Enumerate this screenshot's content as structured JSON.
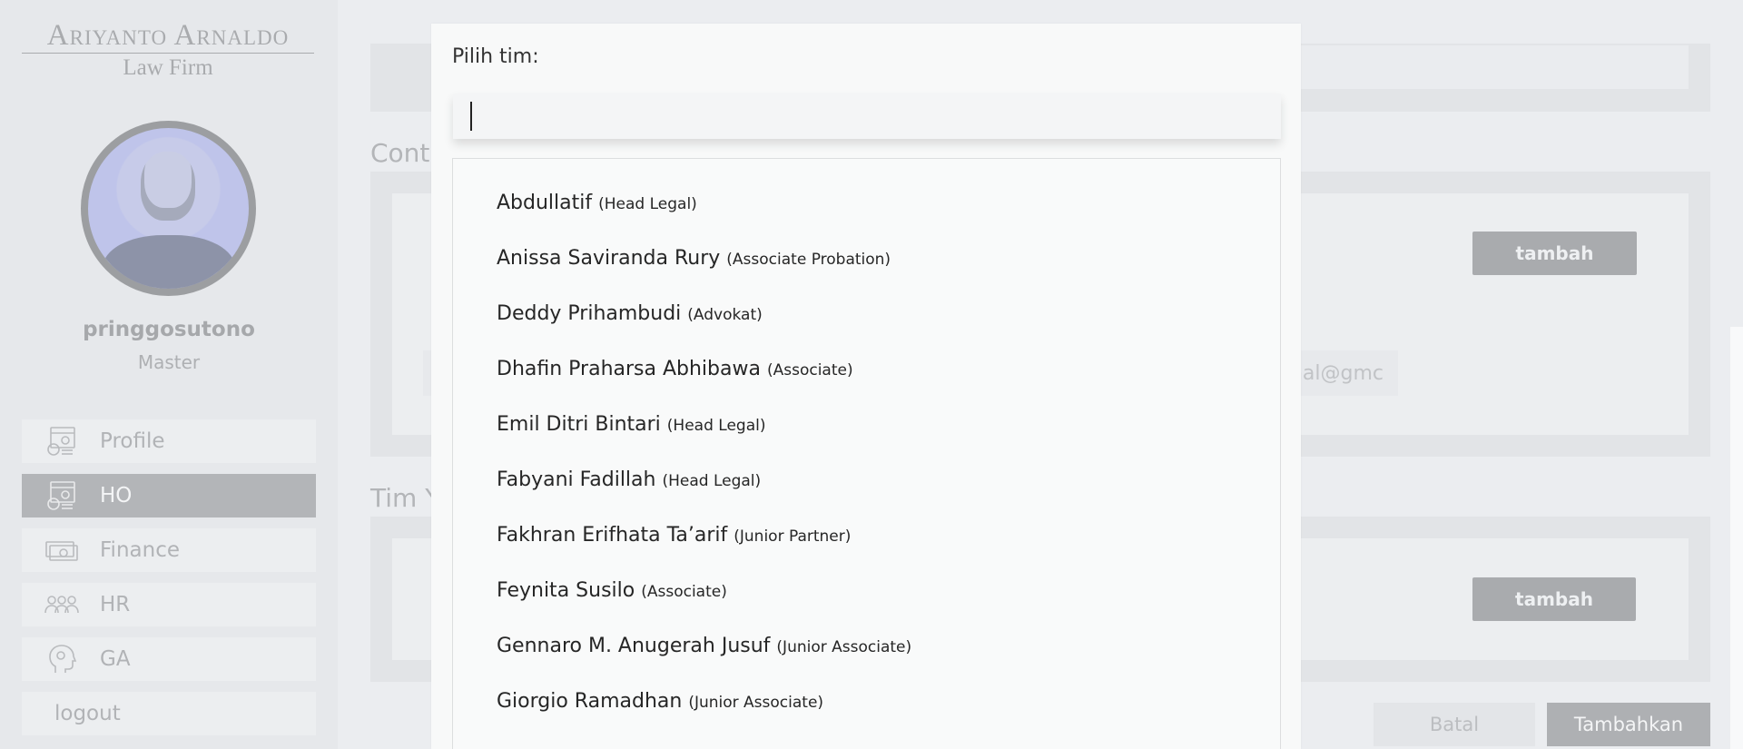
{
  "sidebar": {
    "logo": {
      "line1": "Ariyanto Arnaldo",
      "line2": "Law Firm"
    },
    "user": {
      "name": "pringgosutono",
      "role": "Master"
    },
    "nav": [
      {
        "label": "Profile",
        "icon": "profile-settings-icon"
      },
      {
        "label": "HO",
        "icon": "ho-settings-icon",
        "active": true
      },
      {
        "label": "Finance",
        "icon": "money-icon"
      },
      {
        "label": "HR",
        "icon": "people-icon"
      },
      {
        "label": "GA",
        "icon": "head-gear-icon"
      },
      {
        "label": "logout"
      }
    ]
  },
  "background": {
    "section_contact_title": "Cont",
    "section_team_title": "Tim Y",
    "tambah_label": "tambah",
    "email_placeholder": "nal@gmc",
    "cancel_label": "Batal",
    "submit_label": "Tambahkan"
  },
  "modal": {
    "label": "Pilih tim:",
    "search_value": "",
    "options": [
      {
        "name": "Abdullatif",
        "position": "(Head Legal)"
      },
      {
        "name": "Anissa Saviranda Rury",
        "position": "(Associate Probation)"
      },
      {
        "name": "Deddy Prihambudi",
        "position": "(Advokat)"
      },
      {
        "name": "Dhafin Praharsa Abhibawa",
        "position": "(Associate)"
      },
      {
        "name": "Emil Ditri Bintari",
        "position": "(Head Legal)"
      },
      {
        "name": "Fabyani Fadillah",
        "position": "(Head Legal)"
      },
      {
        "name": "Fakhran Erifhata Ta’arif",
        "position": "(Junior Partner)"
      },
      {
        "name": "Feynita Susilo",
        "position": "(Associate)"
      },
      {
        "name": "Gennaro M. Anugerah Jusuf",
        "position": "(Junior Associate)"
      },
      {
        "name": "Giorgio Ramadhan",
        "position": "(Junior Associate)"
      }
    ]
  },
  "colors": {
    "sidebar_bg": "#e6e8eb",
    "active_nav_bg": "#b3b5b8",
    "button_gray": "#a9abae",
    "modal_bg": "#f8f9f9"
  }
}
